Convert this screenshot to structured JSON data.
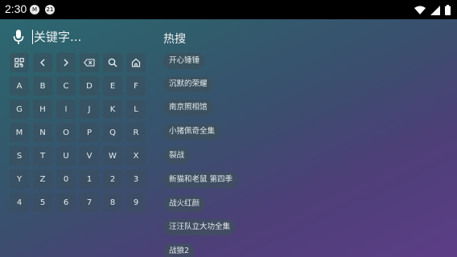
{
  "status_bar": {
    "time": "2:30",
    "notif1": "M",
    "notif2": "21"
  },
  "search": {
    "placeholder": "关键字..."
  },
  "keypad": {
    "tool_row": [
      {
        "name": "qr-icon"
      },
      {
        "name": "cursor-left-icon"
      },
      {
        "name": "cursor-right-icon"
      },
      {
        "name": "backspace-icon"
      },
      {
        "name": "search-icon"
      },
      {
        "name": "home-icon"
      }
    ],
    "keys": [
      "A",
      "B",
      "C",
      "D",
      "E",
      "F",
      "G",
      "H",
      "I",
      "J",
      "K",
      "L",
      "M",
      "N",
      "O",
      "P",
      "Q",
      "R",
      "S",
      "T",
      "U",
      "V",
      "W",
      "X",
      "Y",
      "Z",
      "0",
      "1",
      "2",
      "3",
      "4",
      "5",
      "6",
      "7",
      "8",
      "9"
    ]
  },
  "hot": {
    "title": "热搜",
    "items": [
      "开心锤锤",
      "沉默的荣耀",
      "南京照相馆",
      "小猪佩奇全集",
      "裂战",
      "新猫和老鼠 第四季",
      "战火红颜",
      "汪汪队立大功全集",
      "战狼2"
    ]
  }
}
